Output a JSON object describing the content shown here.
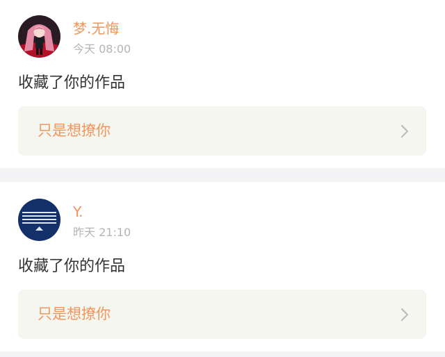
{
  "colors": {
    "accent": "#f3955b",
    "secondary_text": "#b5b5b5",
    "primary_text": "#333333",
    "work_box_bg": "#f6f6f1",
    "separator": "#f4f4f6"
  },
  "notifications": [
    {
      "username": "梦.无悔",
      "time": "今天 08:00",
      "action": "收藏了你的作品",
      "work_title": "只是想撩你",
      "avatar_icon": "anime-girl-avatar"
    },
    {
      "username": "Y.",
      "time": "昨天 21:10",
      "action": "收藏了你的作品",
      "work_title": "只是想撩你",
      "avatar_icon": "navy-stripes-logo-avatar"
    }
  ]
}
